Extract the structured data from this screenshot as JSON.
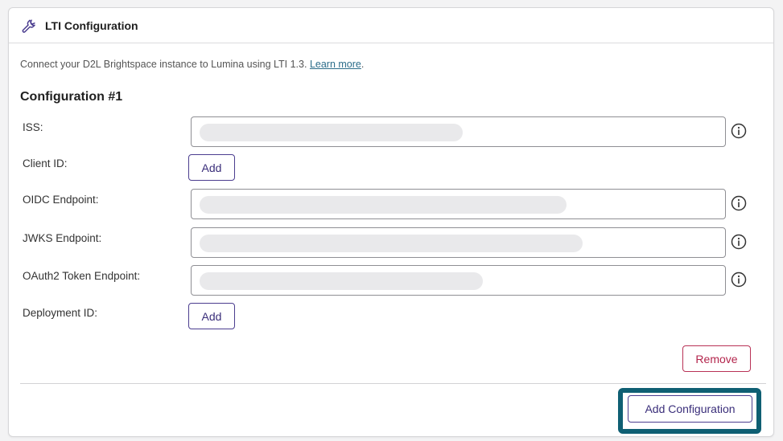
{
  "header": {
    "title": "LTI Configuration",
    "icon": "wrench-icon"
  },
  "intro": {
    "text": "Connect your D2L Brightspace instance to Lumina using LTI 1.3.",
    "link_label": "Learn more",
    "trailing": "."
  },
  "config": {
    "title": "Configuration #1",
    "fields": [
      {
        "label": "ISS:",
        "type": "input",
        "value": ""
      },
      {
        "label": "Client ID:",
        "type": "add",
        "button_label": "Add"
      },
      {
        "label": "OIDC Endpoint:",
        "type": "input",
        "value": ""
      },
      {
        "label": "JWKS Endpoint:",
        "type": "input",
        "value": ""
      },
      {
        "label": "OAuth2 Token Endpoint:",
        "type": "input",
        "value": ""
      },
      {
        "label": "Deployment ID:",
        "type": "add",
        "button_label": "Add"
      }
    ],
    "remove_label": "Remove"
  },
  "footer": {
    "add_configuration_label": "Add Configuration"
  },
  "colors": {
    "accent": "#3a2e7a",
    "danger": "#b3254c",
    "highlight": "#0f5f73",
    "link": "#2c6d8a"
  }
}
